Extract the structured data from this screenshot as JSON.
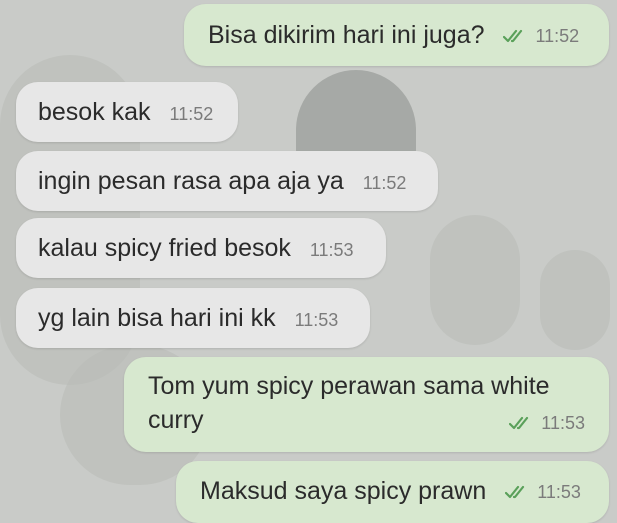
{
  "colors": {
    "background": "#c9cbc8",
    "incoming_bubble": "#e7e7e7",
    "outgoing_bubble": "#d7e8cf",
    "timestamp": "#7b7b7b",
    "tick": "#5aa05a"
  },
  "messages": [
    {
      "direction": "outgoing",
      "text": "Bisa dikirim hari ini juga?",
      "time": "11:52",
      "status_icon": "double-check-icon"
    },
    {
      "direction": "incoming",
      "text": "besok kak",
      "time": "11:52"
    },
    {
      "direction": "incoming",
      "text": "ingin pesan rasa apa aja ya",
      "time": "11:52"
    },
    {
      "direction": "incoming",
      "text": "kalau spicy fried besok",
      "time": "11:53"
    },
    {
      "direction": "incoming",
      "text": "yg lain bisa hari ini kk",
      "time": "11:53"
    },
    {
      "direction": "outgoing",
      "text": "Tom yum spicy perawan sama white curry",
      "time": "11:53",
      "status_icon": "double-check-icon"
    },
    {
      "direction": "outgoing",
      "text": "Maksud saya spicy prawn",
      "time": "11:53",
      "status_icon": "double-check-icon"
    }
  ]
}
